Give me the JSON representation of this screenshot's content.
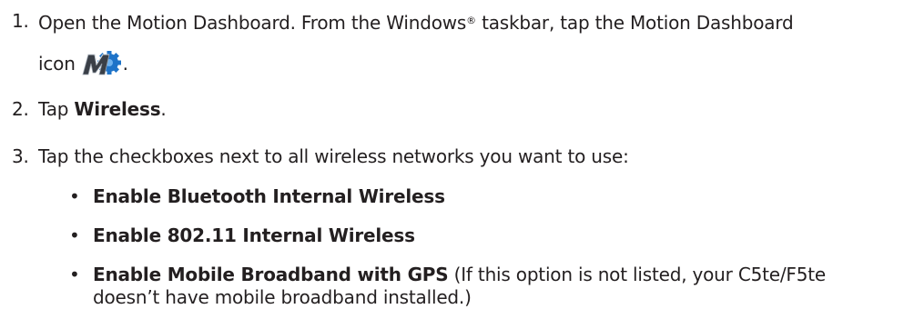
{
  "steps": [
    {
      "number": "1.",
      "line1_pre": "Open the Motion Dashboard. From the Windows",
      "reg": "®",
      "line1_post": " taskbar, tap the Motion Dashboard",
      "line2_pre": "icon",
      "line2_post": ".",
      "icon": "motion-dashboard-icon"
    },
    {
      "number": "2.",
      "pre": "Tap ",
      "bold": "Wireless",
      "post": "."
    },
    {
      "number": "3.",
      "text": "Tap the checkboxes next to all wireless networks you want to use:"
    }
  ],
  "bullets": [
    {
      "marker": "•",
      "bold": "Enable Bluetooth Internal Wireless"
    },
    {
      "marker": "•",
      "bold": "Enable 802.11 Internal Wireless"
    },
    {
      "marker": "•",
      "bold": "Enable Mobile Broadband with GPS",
      "post_line1": " (If this option is not listed, your C5te/F5te",
      "post_line2": "doesn’t have mobile broadband installed.)"
    }
  ],
  "colors": {
    "text": "#231f20",
    "icon_blue": "#1e73c8",
    "icon_dark": "#3a3f47"
  }
}
